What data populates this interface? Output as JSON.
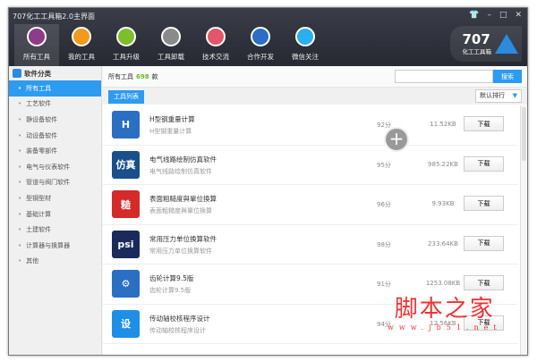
{
  "window": {
    "title": "707化工工具箱2.0主界面",
    "controls": [
      "skin",
      "minimize",
      "maximize",
      "close"
    ]
  },
  "toolbar": [
    {
      "label": "所有工具",
      "icon": "toolbox-icon",
      "color": "#8e3b8a"
    },
    {
      "label": "我的工具",
      "icon": "tools-icon",
      "color": "#f39a1c"
    },
    {
      "label": "工具升级",
      "icon": "upgrade-icon",
      "color": "#7cbf2a"
    },
    {
      "label": "工具卸载",
      "icon": "trash-icon",
      "color": "#8a8a8a"
    },
    {
      "label": "技术交流",
      "icon": "chat-icon",
      "color": "#e4566b"
    },
    {
      "label": "合作开发",
      "icon": "handshake-icon",
      "color": "#2a6fc4"
    },
    {
      "label": "微信关注",
      "icon": "wechat-icon",
      "color": "#2ab0ea"
    }
  ],
  "logo": {
    "number": "707",
    "text": "化工工具箱"
  },
  "sidebar": {
    "title": "软件分类",
    "items": [
      "所有工具",
      "工艺软件",
      "静设备软件",
      "动设备软件",
      "装备零部件",
      "电气与仪表软件",
      "管道与阀门软件",
      "型钢型材",
      "基础计算",
      "土建软件",
      "计算器与换算器",
      "其他"
    ]
  },
  "header": {
    "label": "所有工具",
    "count": "698",
    "unit": "款",
    "search_placeholder": "",
    "search_button": "搜索"
  },
  "tabs": {
    "list": "工具列表",
    "sort": "默认排行"
  },
  "tools": [
    {
      "name": "H型钢重量计算",
      "desc": "H型钢重量计算",
      "score": "92分",
      "size": "11.52KB",
      "icon_text": "H",
      "color": "#2a6fc4"
    },
    {
      "name": "电气线路绘制仿真软件",
      "desc": "电气线路绘制仿真软件",
      "score": "95分",
      "size": "985.22KB",
      "icon_text": "仿真",
      "color": "#1a4f8a"
    },
    {
      "name": "表面粗糙度與單位換算",
      "desc": "表面粗糙度與單位換算",
      "score": "96分",
      "size": "9.93KB",
      "icon_text": "糙",
      "color": "#d42a2a"
    },
    {
      "name": "常用压力单位换算软件",
      "desc": "常用压力单位换算软件",
      "score": "98分",
      "size": "233.64KB",
      "icon_text": "psi",
      "color": "#1a2a5a"
    },
    {
      "name": "齿轮计算9.5版",
      "desc": "齿轮计算9.5版",
      "score": "91分",
      "size": "1253.08KB",
      "icon_text": "⚙",
      "color": "#2a6fc4"
    },
    {
      "name": "传动轴校核程序设计",
      "desc": "传动轴校核程序设计",
      "score": "94分",
      "size": "12.56KB",
      "icon_text": "设",
      "color": "#1e8fe6"
    }
  ],
  "download_label": "下载",
  "watermark": {
    "main": "脚本之家",
    "url": "www.jb51.net"
  }
}
